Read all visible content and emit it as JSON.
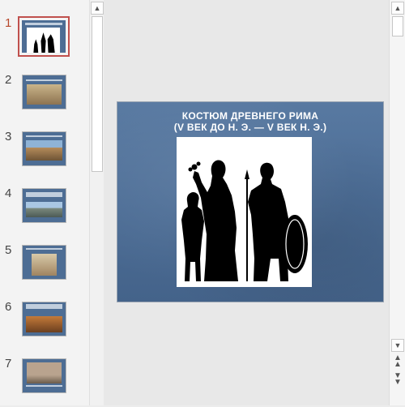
{
  "thumbnails": [
    {
      "number": "1",
      "selected": true
    },
    {
      "number": "2",
      "selected": false
    },
    {
      "number": "3",
      "selected": false
    },
    {
      "number": "4",
      "selected": false
    },
    {
      "number": "5",
      "selected": false
    },
    {
      "number": "6",
      "selected": false
    },
    {
      "number": "7",
      "selected": false
    }
  ],
  "slide": {
    "title_line1": "КОСТЮМ ДРЕВНЕГО РИМА",
    "title_line2": "(V ВЕК ДО Н. Э. — V ВЕК Н. Э.)"
  },
  "colors": {
    "slide_bg": "#4c6d96",
    "selection": "#c0504d",
    "selected_number": "#b7472a"
  },
  "icons": {
    "scroll_up": "triangle-up-icon",
    "scroll_down": "triangle-down-icon",
    "prev_slide": "double-chevron-up-icon",
    "next_slide": "double-chevron-down-icon"
  }
}
